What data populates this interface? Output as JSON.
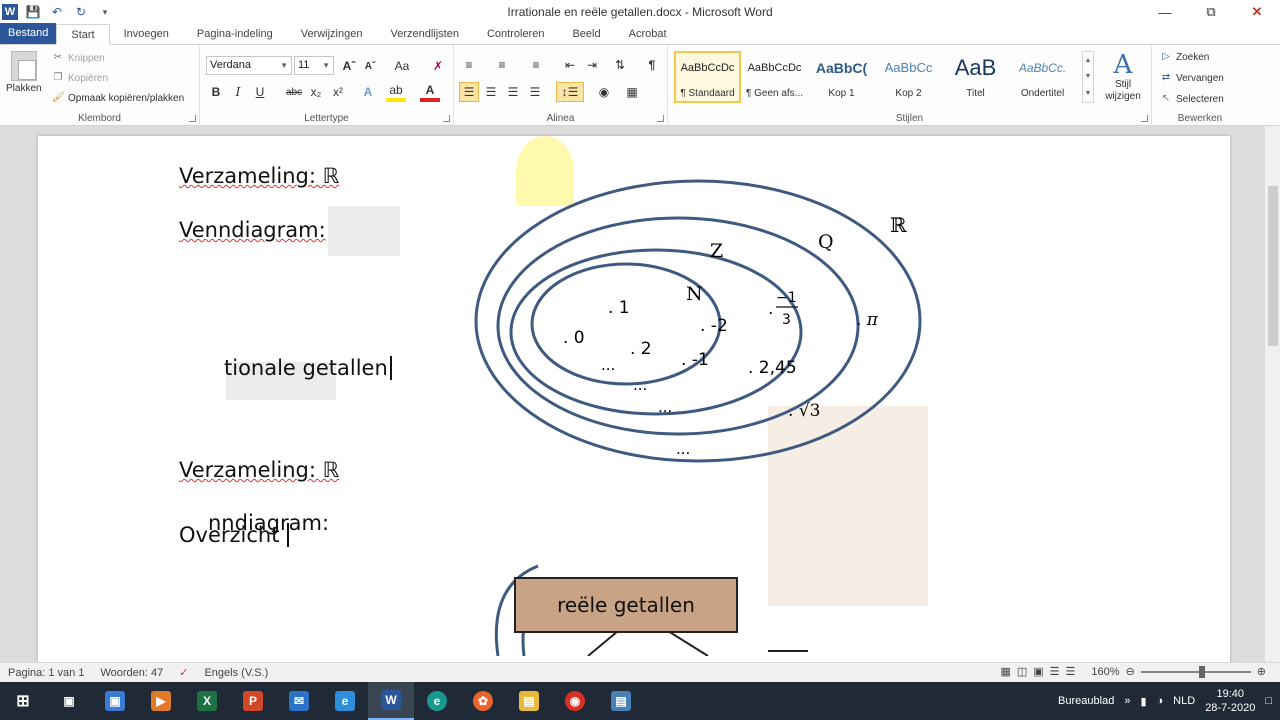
{
  "window": {
    "title": "Irrationale en reële getallen.docx  -  Microsoft Word",
    "app_icon": "W"
  },
  "tabs": [
    "Bestand",
    "Start",
    "Invoegen",
    "Pagina-indeling",
    "Verwijzingen",
    "Verzendlijsten",
    "Controleren",
    "Beeld",
    "Acrobat"
  ],
  "ribbon": {
    "clipboard": {
      "label": "Klembord",
      "paste": "Plakken",
      "cut": "Knippen",
      "copy": "Kopiëren",
      "format_painter": "Opmaak kopiëren/plakken"
    },
    "font": {
      "label": "Lettertype",
      "family": "Verdana",
      "size": "11"
    },
    "paragraph": {
      "label": "Alinea"
    },
    "styles": {
      "label": "Stijlen",
      "items": [
        {
          "sample": "AaBbCcDc",
          "name": "¶ Standaard"
        },
        {
          "sample": "AaBbCcDc",
          "name": "¶ Geen afs..."
        },
        {
          "sample": "AaBbC(",
          "name": "Kop 1"
        },
        {
          "sample": "AaBbCc",
          "name": "Kop 2"
        },
        {
          "sample": "AaB",
          "name": "Titel"
        },
        {
          "sample": "AaBbCc.",
          "name": "Ondertitel"
        }
      ],
      "change": "Stijl wijzigen"
    },
    "editing": {
      "label": "Bewerken",
      "find": "Zoeken",
      "replace": "Vervangen",
      "select": "Selecteren"
    }
  },
  "document": {
    "lines": {
      "l1": "Verzameling: ℝ",
      "l2": "Venndiagram:",
      "l3": "tionale getallen",
      "l4": "Verzameling: ℝ",
      "l5": "nndiagram:",
      "l6": "Overzicht"
    },
    "venn": {
      "set_labels": {
        "R": "ℝ",
        "Q": "Q",
        "Z": "Z",
        "N": "N"
      },
      "points": [
        ". 1",
        ". 0",
        ". 2",
        "...",
        ". -2",
        ". -1",
        "...",
        "...",
        "...",
        ". 2,45",
        ". π",
        ". √3",
        ". "
      ],
      "fraction": {
        "num": "−1",
        "den": "3"
      }
    },
    "box_label": "reële getallen"
  },
  "status": {
    "page": "Pagina: 1 van 1",
    "words": "Woorden: 47",
    "language": "Engels (V.S.)",
    "zoom": "160%"
  },
  "taskbar": {
    "desktop": "Bureaublad",
    "lang": "NLD",
    "time": "19:40",
    "date": "28-7-2020"
  }
}
